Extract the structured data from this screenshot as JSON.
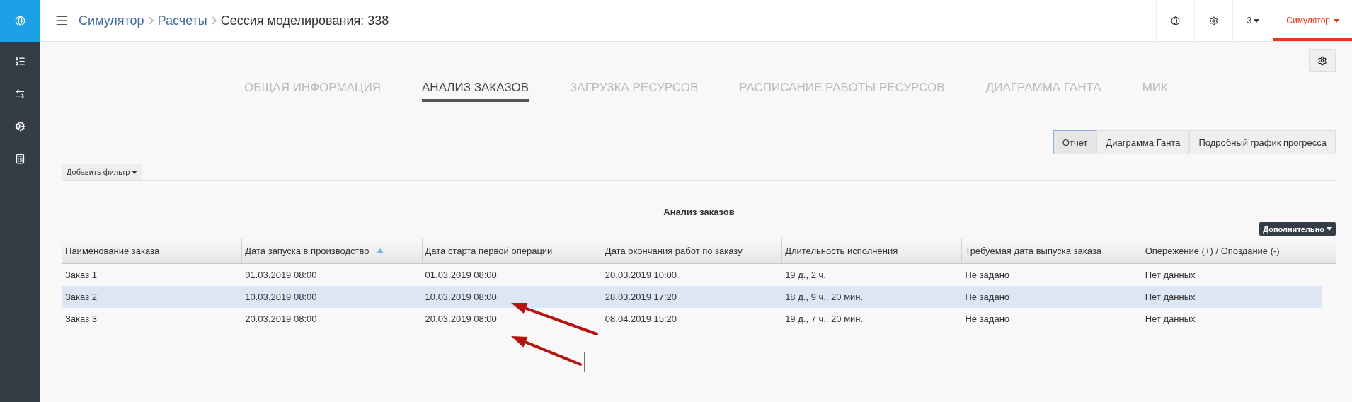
{
  "breadcrumb": [
    {
      "label": "Симулятор",
      "kind": "link"
    },
    {
      "label": "Расчеты",
      "kind": "link"
    },
    {
      "label": "Сессия моделирования: 338",
      "kind": "current"
    }
  ],
  "topbar": {
    "user_menu": "3",
    "app_menu": {
      "label": "Симулятор",
      "selected": true
    }
  },
  "tabs": [
    {
      "label": "ОБЩАЯ ИНФОРМАЦИЯ",
      "selected": false
    },
    {
      "label": "АНАЛИЗ ЗАКАЗОВ",
      "selected": true
    },
    {
      "label": "ЗАГРУЗКА РЕСУРСОВ",
      "selected": false
    },
    {
      "label": "РАСПИСАНИЕ РАБОТЫ РЕСУРСОВ",
      "selected": false
    },
    {
      "label": "ДИАГРАММА ГАНТА",
      "selected": false
    },
    {
      "label": "МИК",
      "selected": false
    }
  ],
  "view_buttons": [
    {
      "label": "Отчет",
      "selected": true
    },
    {
      "label": "Диаграмма Ганта",
      "selected": false
    },
    {
      "label": "Подробный график прогресса",
      "selected": false
    }
  ],
  "filter_button": "Добавить фильтр",
  "report": {
    "title": "Анализ заказов",
    "more_button": "Дополнительно",
    "columns": [
      {
        "label": "Наименование заказа",
        "sorted": false
      },
      {
        "label": "Дата запуска в производство",
        "sorted": true
      },
      {
        "label": "Дата старта первой операции",
        "sorted": false
      },
      {
        "label": "Дата окончания работ по заказу",
        "sorted": false
      },
      {
        "label": "Длительность исполнения",
        "sorted": false
      },
      {
        "label": "Требуемая дата выпуска заказа",
        "sorted": false
      },
      {
        "label": "Опережение (+) / Опоздание (-)",
        "sorted": false
      }
    ],
    "rows": [
      {
        "selected": false,
        "cells": [
          "Заказ 1",
          "01.03.2019 08:00",
          "01.03.2019 08:00",
          "20.03.2019 10:00",
          "19 д., 2 ч.",
          "Не задано",
          "Нет данных"
        ]
      },
      {
        "selected": true,
        "cells": [
          "Заказ 2",
          "10.03.2019 08:00",
          "10.03.2019 08:00",
          "28.03.2019 17:20",
          "18 д., 9 ч., 20 мин.",
          "Не задано",
          "Нет данных"
        ]
      },
      {
        "selected": false,
        "cells": [
          "Заказ 3",
          "20.03.2019 08:00",
          "20.03.2019 08:00",
          "08.04.2019 15:20",
          "19 д., 7 ч., 20 мин.",
          "Не задано",
          "Нет данных"
        ]
      }
    ]
  }
}
